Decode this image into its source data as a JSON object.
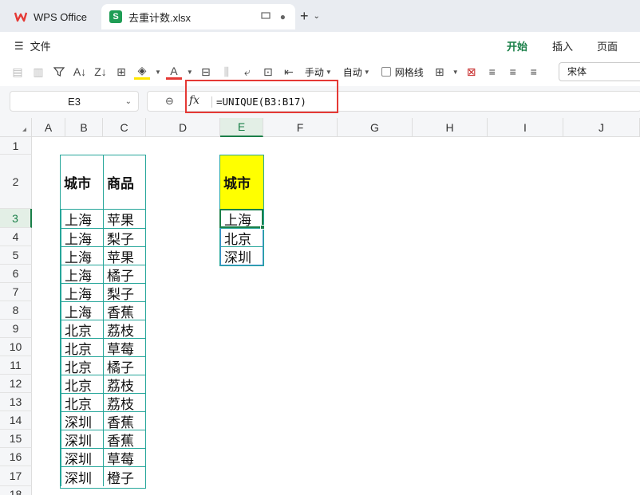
{
  "tabs": {
    "app_tab": "WPS Office",
    "file_tab": "去重计数.xlsx"
  },
  "menu": {
    "file": "文件",
    "ribbon_tabs": [
      "开始",
      "插入",
      "页面"
    ],
    "active_tab": "开始"
  },
  "toolbar": {
    "wrap_label": "手动",
    "auto_label": "自动",
    "gridlines_label": "网格线",
    "font_name": "宋体"
  },
  "formula_bar": {
    "cell_ref": "E3",
    "fx": "fx",
    "formula": "=UNIQUE(B3:B17)"
  },
  "grid": {
    "columns": [
      "A",
      "B",
      "C",
      "D",
      "E",
      "F",
      "G",
      "H",
      "I",
      "J"
    ],
    "rows": [
      "1",
      "2",
      "3",
      "4",
      "5",
      "6",
      "7",
      "8",
      "9",
      "10",
      "11",
      "12",
      "13",
      "14",
      "15",
      "16",
      "17",
      "18"
    ],
    "selected_column": "E",
    "selected_row": "3"
  },
  "source_table": {
    "headers": [
      "城市",
      "商品"
    ],
    "rows": [
      [
        "上海",
        "苹果"
      ],
      [
        "上海",
        "梨子"
      ],
      [
        "上海",
        "苹果"
      ],
      [
        "上海",
        "橘子"
      ],
      [
        "上海",
        "梨子"
      ],
      [
        "上海",
        "香蕉"
      ],
      [
        "北京",
        "荔枝"
      ],
      [
        "北京",
        "草莓"
      ],
      [
        "北京",
        "橘子"
      ],
      [
        "北京",
        "荔枝"
      ],
      [
        "北京",
        "荔枝"
      ],
      [
        "深圳",
        "香蕉"
      ],
      [
        "深圳",
        "香蕉"
      ],
      [
        "深圳",
        "草莓"
      ],
      [
        "深圳",
        "橙子"
      ]
    ]
  },
  "result_table": {
    "header": "城市",
    "values": [
      "上海",
      "北京",
      "深圳"
    ]
  },
  "colors": {
    "accent": "#1a7f48",
    "highlight": "#ffff00",
    "table_border": "#26a69a",
    "annotation": "#e53935"
  }
}
